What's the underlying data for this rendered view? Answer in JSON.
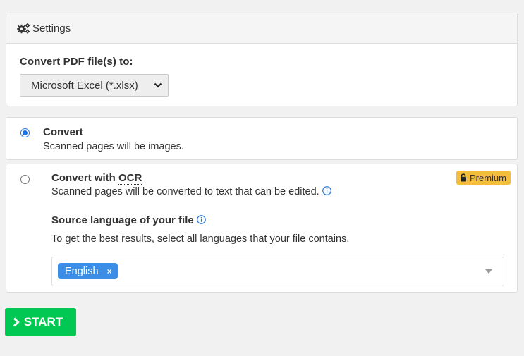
{
  "settings": {
    "header_title": "Settings",
    "header_icon": "gears-icon",
    "convert_label": "Convert PDF file(s) to:",
    "format_select": {
      "selected": "Microsoft Excel (*.xlsx)"
    }
  },
  "options": [
    {
      "title": "Convert",
      "description": "Scanned pages will be images.",
      "checked": true
    },
    {
      "title_prefix": "Convert with ",
      "title_abbr": "OCR",
      "description": "Scanned pages will be converted to text that can be edited.",
      "checked": false,
      "badge": "Premium",
      "source_language_label": "Source language of your file",
      "source_language_hint": "To get the best results, select all languages that your file contains.",
      "languages": [
        "English"
      ],
      "tag_remove": "×"
    }
  ],
  "start_button": {
    "label": "START"
  },
  "colors": {
    "accent_blue": "#1a73e8",
    "tag_blue": "#3b8de6",
    "premium_yellow": "#f5bd3d",
    "start_green": "#00c853",
    "background": "#f1f1f1"
  }
}
